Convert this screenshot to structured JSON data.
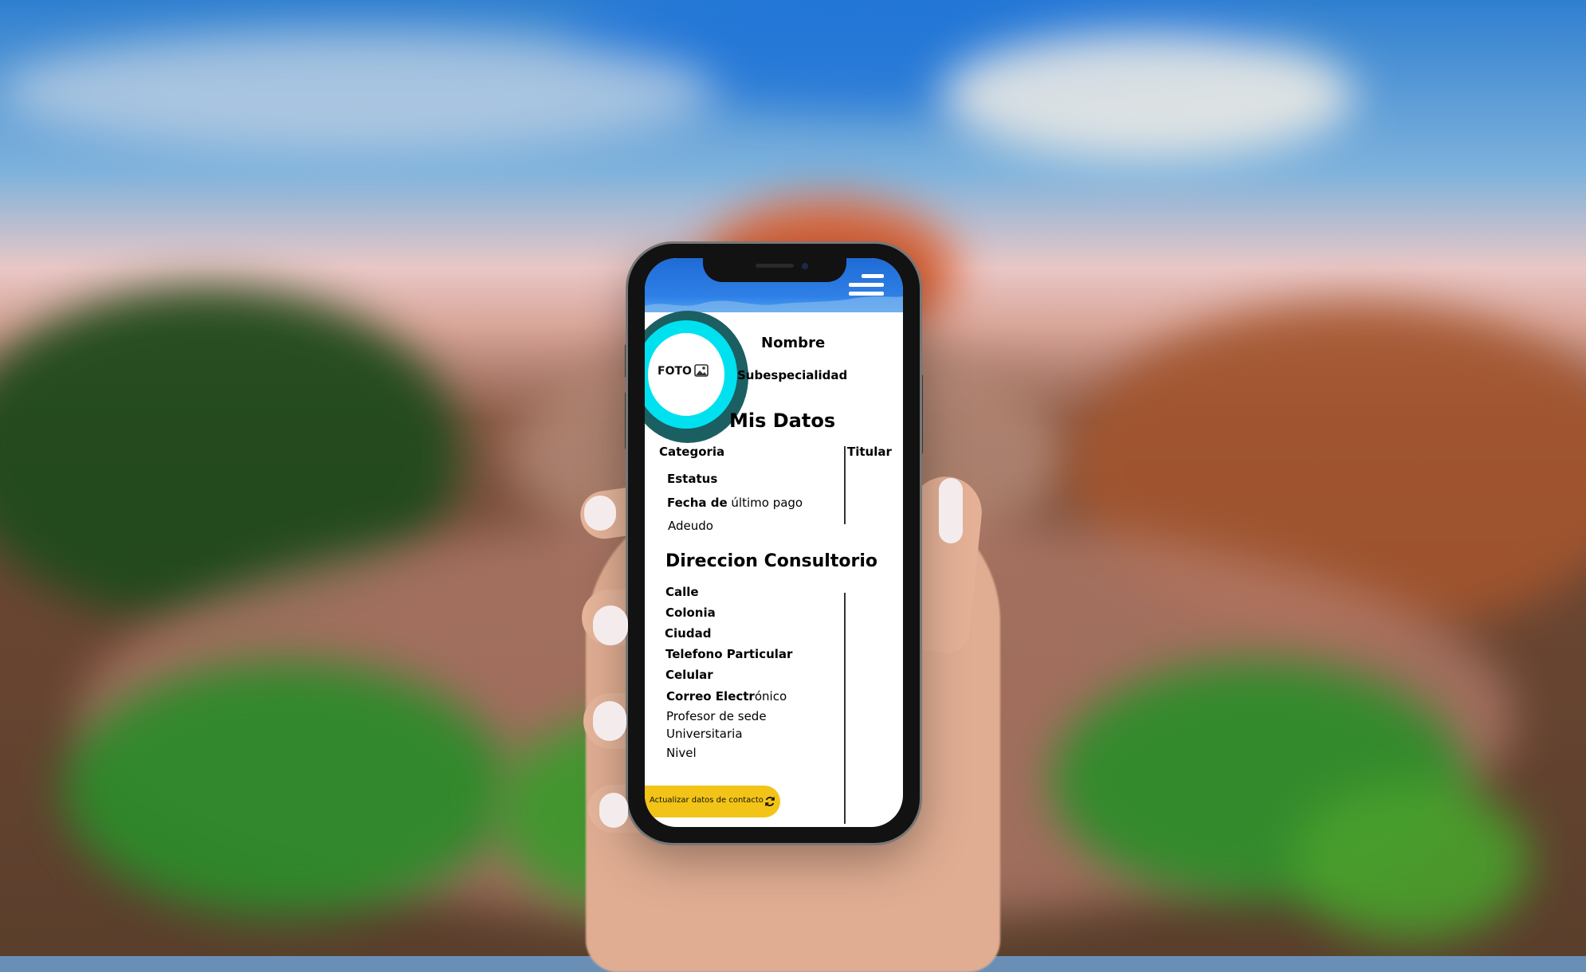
{
  "header": {
    "menu_icon": "hamburger-menu-icon",
    "accent": "#2e7fe6"
  },
  "profile": {
    "photo_label": "FOTO",
    "photo_icon": "image-icon",
    "name_label": "Nombre",
    "subspecialty_label": "Subespecialidad",
    "ring_colors": [
      "#1b5f62",
      "#00e1ef"
    ]
  },
  "mis_datos": {
    "title": "Mis Datos",
    "category_label": "Categoria",
    "category_value": "Titular",
    "status_label": "Estatus",
    "last_payment_label_bold": "Fecha de",
    "last_payment_label_rest": " último pago",
    "debt_label": "Adeudo"
  },
  "direccion": {
    "title": "Direccion Consultorio",
    "street_label": "Calle",
    "colonia_label": "Colonia",
    "city_label": "Ciudad",
    "phone_label": "Telefono Particular",
    "mobile_label": "Celular",
    "email_label_bold": "Correo Electr",
    "email_label_rest": "ónico",
    "professor_label_line1": "Profesor de sede",
    "professor_label_line2": "Universitaria",
    "level_label": "Nivel"
  },
  "actions": {
    "update_contact_label": "Actualizar datos de contacto",
    "update_icon": "refresh-icon",
    "button_color": "#f2c417"
  }
}
